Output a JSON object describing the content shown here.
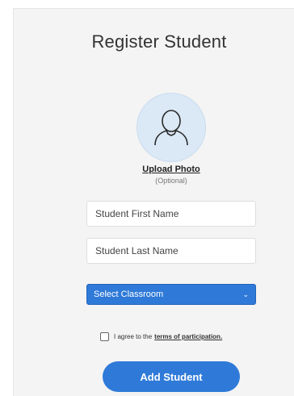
{
  "form": {
    "title": "Register Student",
    "upload_label": "Upload Photo",
    "upload_hint": "(Optional)",
    "first_name_placeholder": "Student First Name",
    "last_name_placeholder": "Student Last Name",
    "classroom_select": {
      "selected": "Select Classroom"
    },
    "agree_text": "I agree to the",
    "terms_link": "terms of participation.",
    "submit_label": "Add Student"
  },
  "icons": {
    "avatar": "user-silhouette-icon",
    "select_caret": "chevron-down-icon",
    "checkbox": "checkbox-unchecked-icon"
  },
  "colors": {
    "accent": "#2f7ad8",
    "avatar_bg": "#dbe9f6",
    "card_bg": "#f4f4f4"
  }
}
